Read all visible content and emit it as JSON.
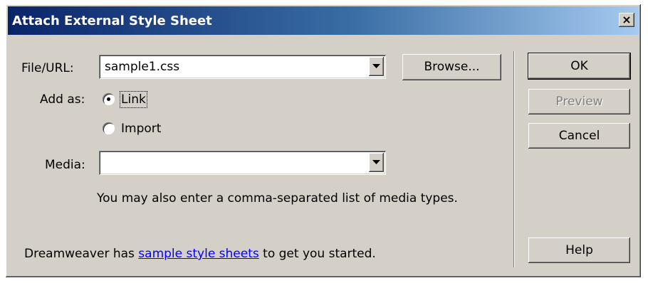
{
  "window": {
    "title": "Attach External Style Sheet",
    "close_glyph": "×"
  },
  "file_url": {
    "label": "File/URL:",
    "value": "sample1.css"
  },
  "browse_label": "Browse...",
  "add_as": {
    "label": "Add as:",
    "options": [
      {
        "label": "Link",
        "selected": true
      },
      {
        "label": "Import",
        "selected": false
      }
    ]
  },
  "media": {
    "label": "Media:",
    "value": ""
  },
  "hint": "You may also enter a comma-separated list of media types.",
  "footer": {
    "prefix": "Dreamweaver has ",
    "link": "sample style sheets",
    "suffix": " to get you started."
  },
  "buttons": {
    "ok": "OK",
    "preview": "Preview",
    "cancel": "Cancel",
    "help": "Help"
  },
  "colors": {
    "face": "#d4d0c8",
    "title_start": "#0a246a",
    "title_end": "#a6caf0",
    "link": "#0000ff"
  },
  "icons": {
    "dropdown": "chevron-down-icon",
    "close": "close-icon"
  }
}
